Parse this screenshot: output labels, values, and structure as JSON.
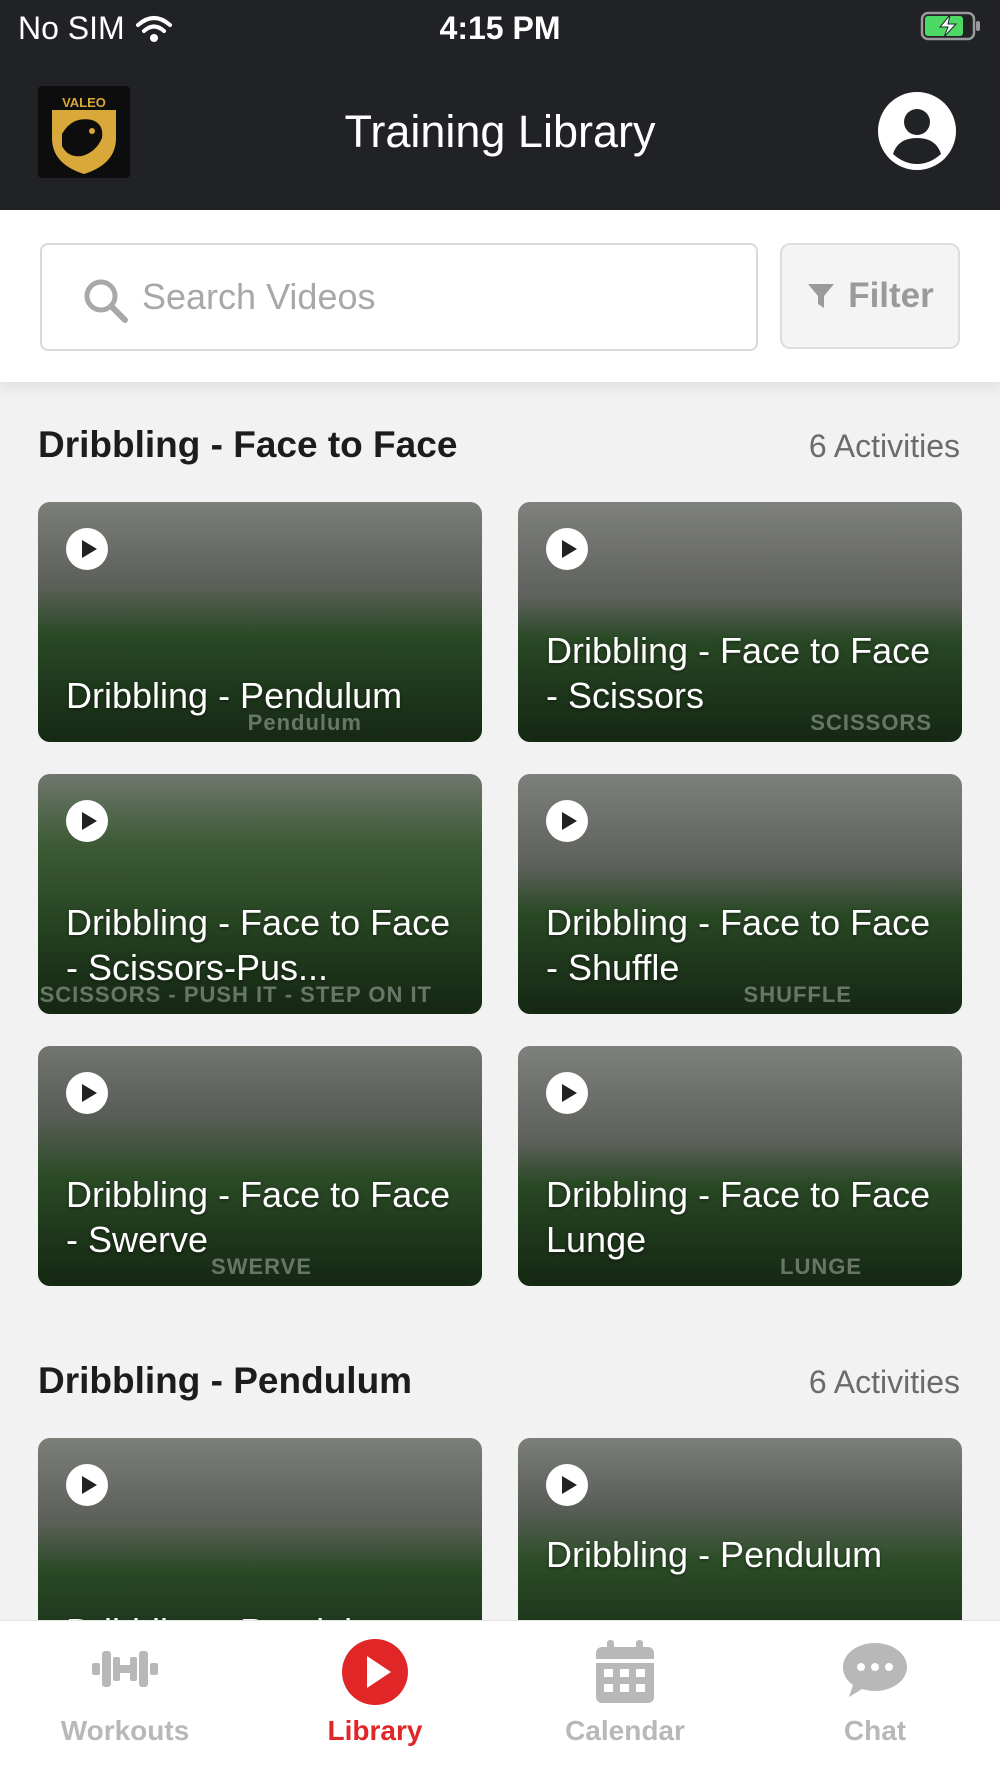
{
  "status_bar": {
    "carrier": "No SIM",
    "time": "4:15 PM"
  },
  "header": {
    "logo_text": "VALEO",
    "title": "Training Library"
  },
  "search": {
    "placeholder": "Search Videos",
    "filter_label": "Filter"
  },
  "sections": [
    {
      "title": "Dribbling - Face to Face",
      "count": "6 Activities",
      "videos": [
        {
          "title": "Dribbling - Pendulum",
          "overlay": "Pendulum"
        },
        {
          "title": "Dribbling - Face to Face - Scissors",
          "overlay": "SCISSORS"
        },
        {
          "title": "Dribbling - Face to Face - Scissors-Pus...",
          "overlay": "SCISSORS - PUSH IT - STEP ON IT"
        },
        {
          "title": "Dribbling - Face to Face - Shuffle",
          "overlay": "SHUFFLE"
        },
        {
          "title": "Dribbling - Face to Face - Swerve",
          "overlay": "SWERVE"
        },
        {
          "title": "Dribbling - Face to Face Lunge",
          "overlay": "LUNGE"
        }
      ]
    },
    {
      "title": "Dribbling - Pendulum",
      "count": "6 Activities",
      "videos": [
        {
          "title": "Dribbling - Pendulum",
          "overlay": ""
        },
        {
          "title": "Dribbling - Pendulum",
          "overlay": ""
        }
      ]
    }
  ],
  "tabs": [
    {
      "label": "Workouts",
      "icon": "dumbbell-icon"
    },
    {
      "label": "Library",
      "icon": "play-circle-icon",
      "active": true
    },
    {
      "label": "Calendar",
      "icon": "calendar-icon"
    },
    {
      "label": "Chat",
      "icon": "chat-bubble-icon"
    }
  ],
  "colors": {
    "header_bg": "#212226",
    "accent": "#e02626",
    "inactive_tab": "#b8b8b8"
  }
}
